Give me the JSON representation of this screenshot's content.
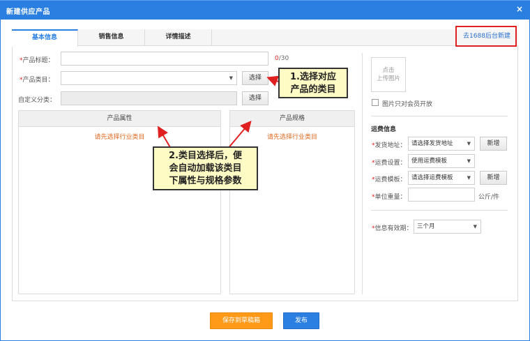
{
  "dialog": {
    "title": "新建供应产品",
    "close_icon": "×"
  },
  "tabs": [
    {
      "label": "基本信息",
      "active": true
    },
    {
      "label": "销售信息",
      "active": false
    },
    {
      "label": "详情描述",
      "active": false
    }
  ],
  "top_link": "去1688后台新建",
  "form": {
    "product_title": {
      "required_mark": "*",
      "label": "产品标题：",
      "value": "",
      "counter_current": "0",
      "counter_max": "/30"
    },
    "product_category": {
      "required_mark": "*",
      "label": "产品类目：",
      "value": "",
      "button": "选择"
    },
    "custom_category": {
      "label": "自定义分类：",
      "value": "",
      "button": "选择"
    }
  },
  "attributes_box": {
    "title": "产品属性",
    "hint": "请先选择行业类目"
  },
  "specs_box": {
    "title": "产品规格",
    "hint": "请先选择行业类目"
  },
  "image": {
    "upload_line1": "点击",
    "upload_line2": "上传图片",
    "members_only_label": "图片只对会员开放"
  },
  "shipping": {
    "section_title": "运费信息",
    "ship_from": {
      "required_mark": "*",
      "label": "发货地址：",
      "value": "请选择发货地址",
      "button": "新增"
    },
    "freight_setting": {
      "required_mark": "*",
      "label": "运费设置：",
      "value": "使用运费模板"
    },
    "freight_template": {
      "required_mark": "*",
      "label": "运费模板：",
      "value": "请选择运费模板",
      "button": "新增"
    },
    "unit_weight": {
      "required_mark": "*",
      "label": "单位重量：",
      "value": "",
      "unit": "公斤/件"
    }
  },
  "validity": {
    "required_mark": "*",
    "label": "信息有效期：",
    "value": "三个月"
  },
  "callouts": {
    "note1_line1": "1.选择对应",
    "note1_line2": "产品的类目",
    "note2_line1": "2.类目选择后，便",
    "note2_line2": "会自动加载该类目",
    "note2_line3": "下属性与规格参数"
  },
  "footer": {
    "save_draft": "保存到草稿箱",
    "publish": "发布"
  },
  "colors": {
    "accent": "#2a7fe0",
    "primary_orange": "#ff9a18",
    "required_red": "#e02020",
    "hint_orange": "#e06a20",
    "note_yellow": "#fffbc4"
  }
}
